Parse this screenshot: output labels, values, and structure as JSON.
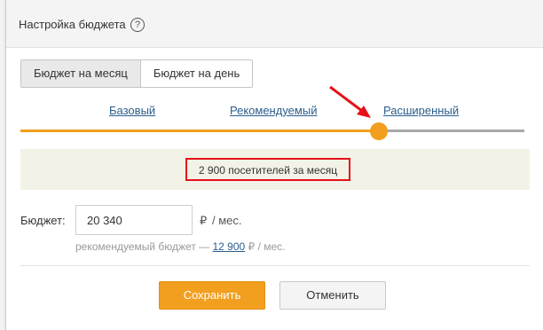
{
  "modal": {
    "title": "Настройка бюджета",
    "help_icon": "?"
  },
  "tabs": [
    {
      "label": "Бюджет на месяц",
      "active": true
    },
    {
      "label": "Бюджет на день",
      "active": false
    }
  ],
  "levels": [
    {
      "label": "Базовый"
    },
    {
      "label": "Рекомендуемый"
    },
    {
      "label": "Расширенный"
    }
  ],
  "selected_level": "Расширенный",
  "visitors": {
    "text": "2 900 посетителей за месяц"
  },
  "budget": {
    "label": "Бюджет:",
    "value": "20 340",
    "currency": "₽",
    "per_month": "/ мес.",
    "recommended_prefix": "рекомендуемый бюджет —",
    "recommended_value": "12 900",
    "recommended_currency": "₽",
    "recommended_per_month": "/ мес."
  },
  "buttons": {
    "save": "Сохранить",
    "cancel": "Отменить"
  },
  "colors": {
    "accent": "#f29f1f",
    "link": "#2a5d8b",
    "annotation": "#e6111a"
  },
  "icons": {
    "help": "question-circle-icon",
    "annotation": "red-arrow-icon"
  }
}
